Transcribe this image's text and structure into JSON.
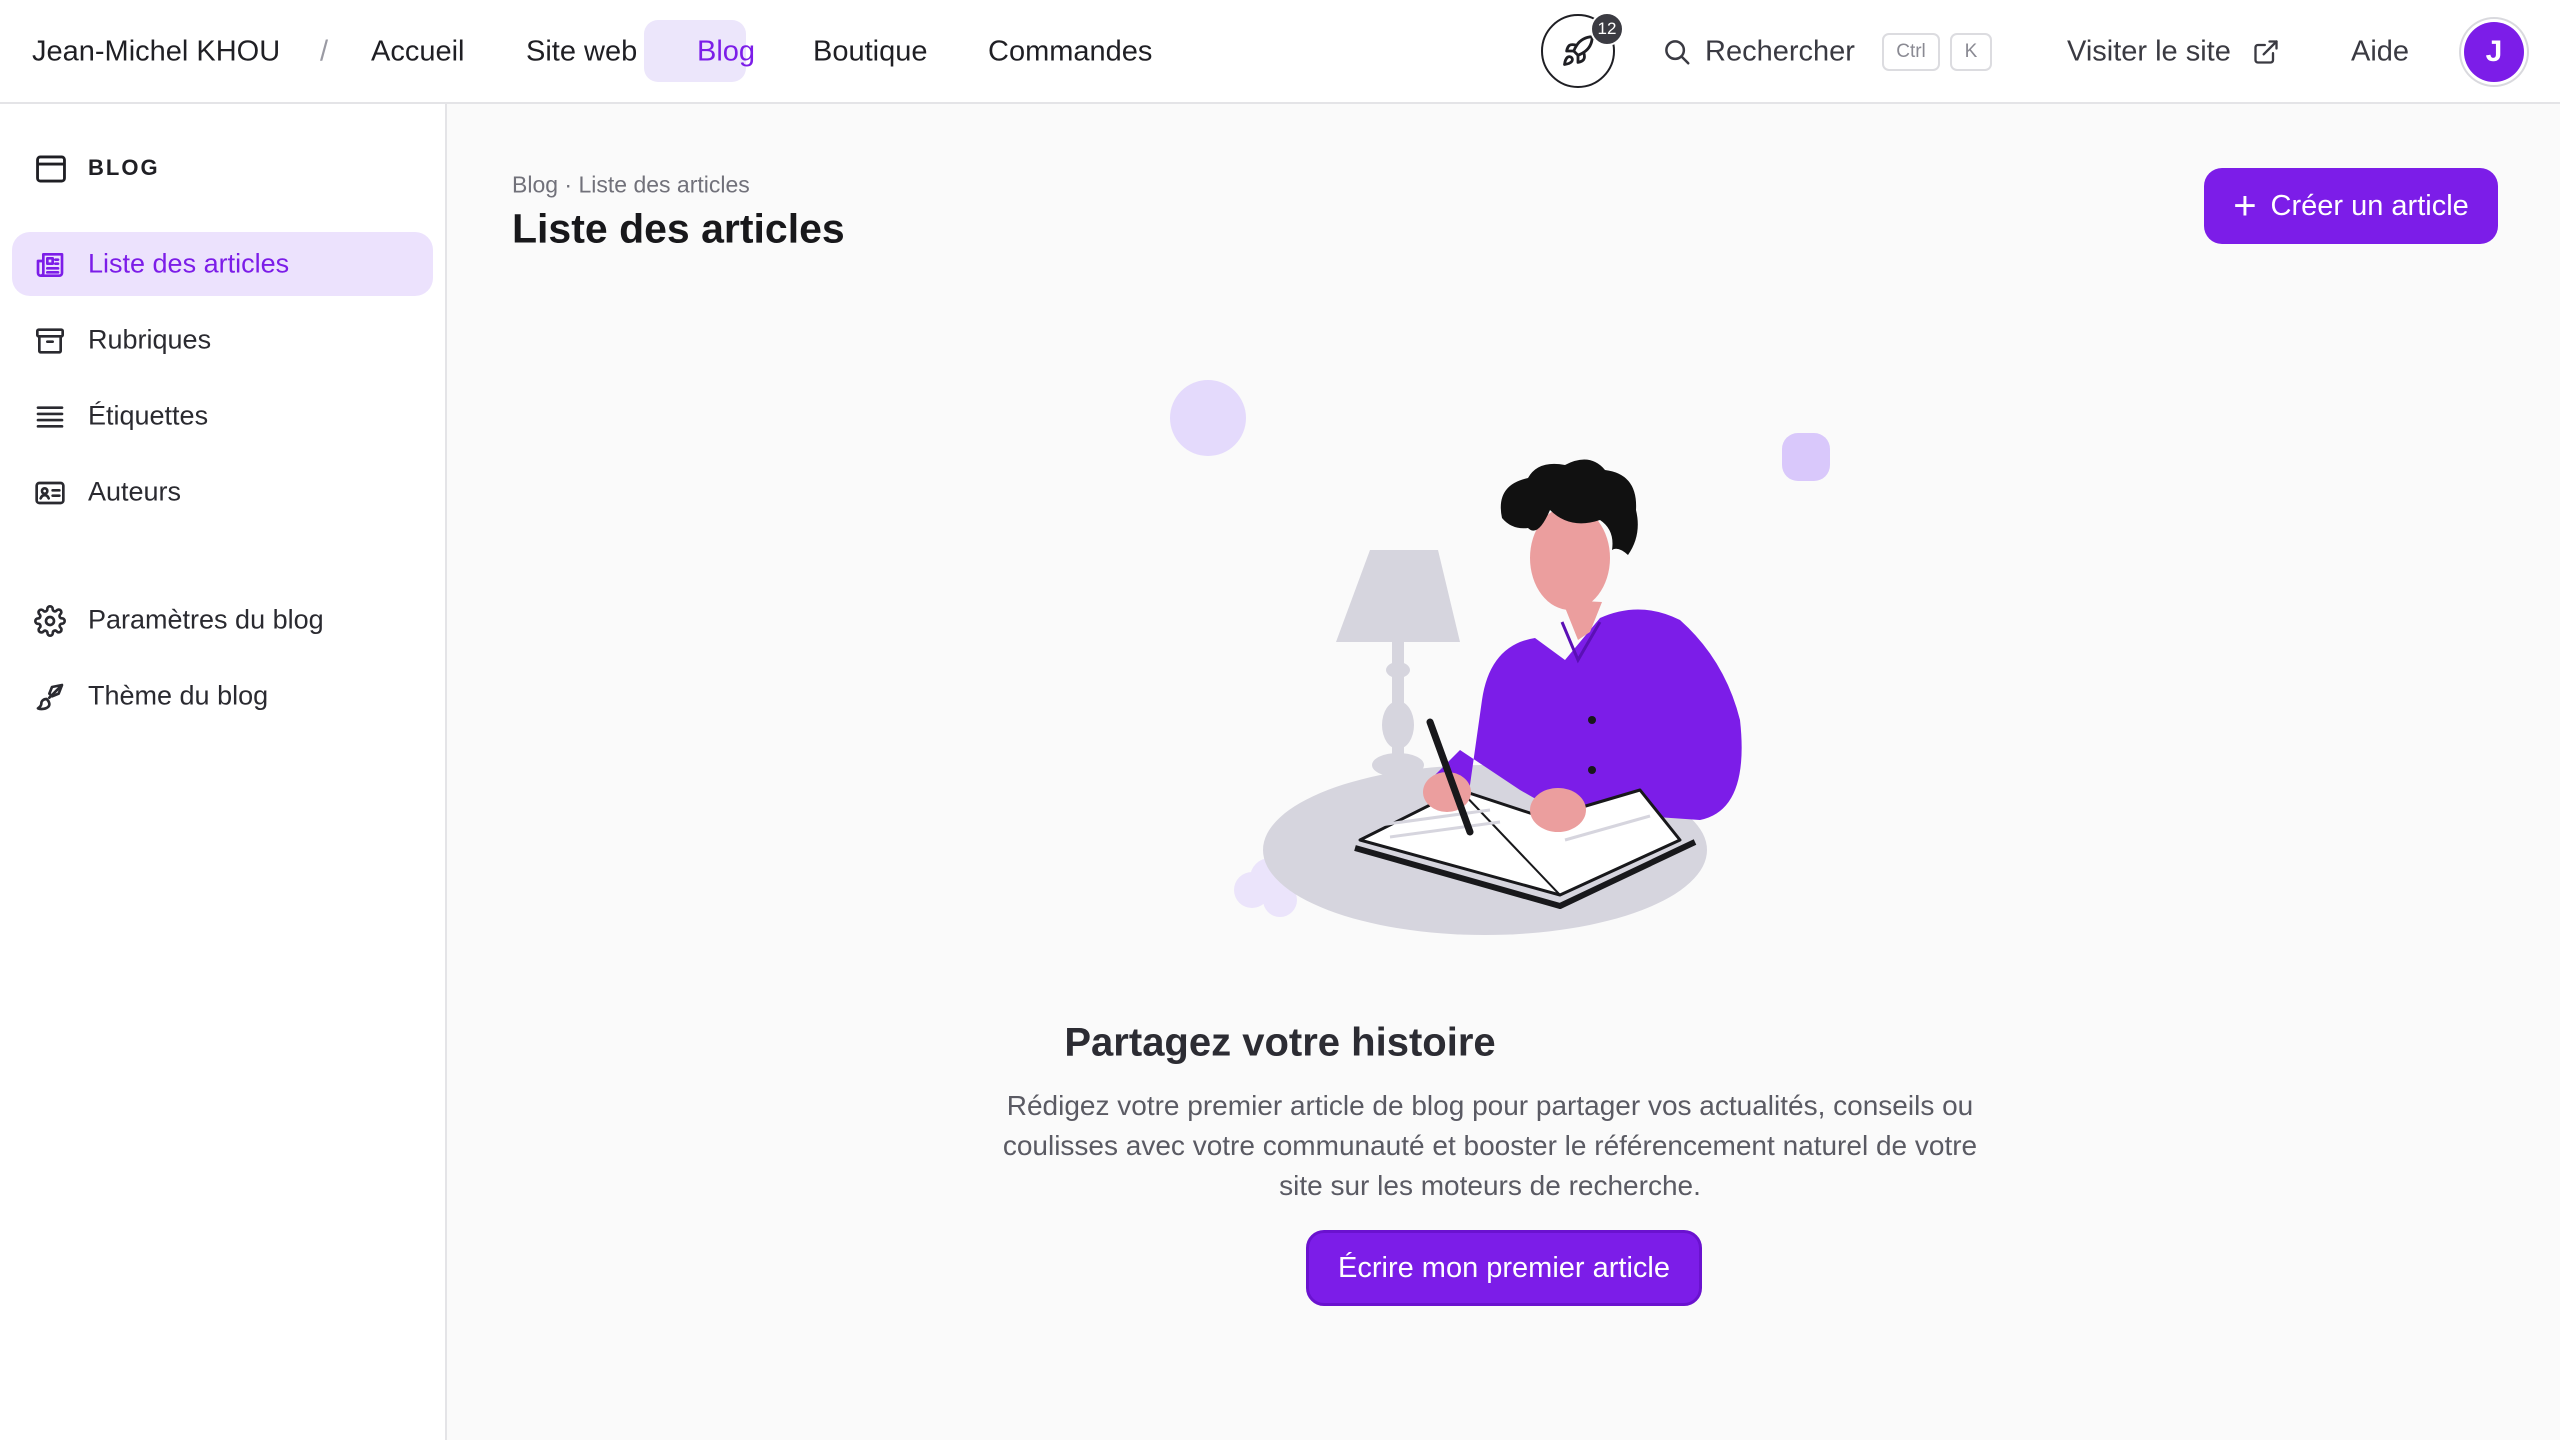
{
  "topbar": {
    "user_name": "Jean-Michel KHOU",
    "separator": "/",
    "nav": [
      {
        "label": "Accueil"
      },
      {
        "label": "Site web"
      },
      {
        "label": "Blog"
      },
      {
        "label": "Boutique"
      },
      {
        "label": "Commandes"
      }
    ],
    "active_nav": "Blog",
    "notifications_count": "12",
    "search_label": "Rechercher",
    "shortcut_keys": [
      "Ctrl",
      "K"
    ],
    "visit_site_label": "Visiter le site",
    "help_label": "Aide",
    "avatar_initial": "J"
  },
  "sidebar": {
    "section_title": "BLOG",
    "items": [
      {
        "label": "Liste des articles",
        "icon": "newspaper-icon",
        "active": true
      },
      {
        "label": "Rubriques",
        "icon": "archive-icon",
        "active": false
      },
      {
        "label": "Étiquettes",
        "icon": "list-lines-icon",
        "active": false
      },
      {
        "label": "Auteurs",
        "icon": "id-card-icon",
        "active": false
      },
      {
        "label": "Paramètres du blog",
        "icon": "gear-icon",
        "active": false
      },
      {
        "label": "Thème du blog",
        "icon": "paintbrush-icon",
        "active": false
      }
    ]
  },
  "main": {
    "breadcrumb": "Blog · Liste des articles",
    "title": "Liste des articles",
    "create_button_label": "Créer un article",
    "empty_state": {
      "title": "Partagez votre histoire",
      "description": "Rédigez votre premier article de blog pour partager vos actualités, conseils ou coulisses avec votre communauté et booster le référencement naturel de votre site sur les moteurs de recherche.",
      "button_label": "Écrire mon premier article"
    }
  },
  "colors": {
    "accent": "#7c1de8",
    "accent_light": "#ece2fd",
    "background": "#fafafa"
  }
}
